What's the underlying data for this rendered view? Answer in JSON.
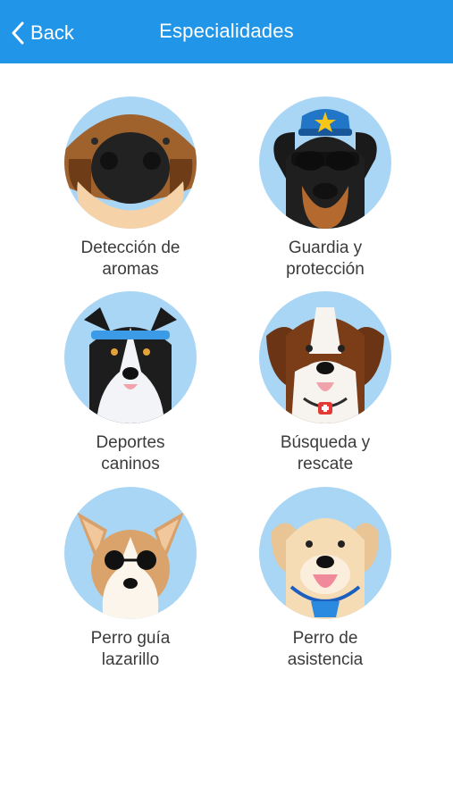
{
  "nav": {
    "back_label": "Back",
    "title": "Especialidades",
    "color": "#2196e8"
  },
  "items": [
    {
      "label_1": "Detección de",
      "label_2": "aromas",
      "icon": "scent-detection-dog-icon"
    },
    {
      "label_1": "Guardia y",
      "label_2": "protección",
      "icon": "guard-dog-icon"
    },
    {
      "label_1": "Deportes",
      "label_2": "caninos",
      "icon": "sports-dog-icon"
    },
    {
      "label_1": "Búsqueda y",
      "label_2": "rescate",
      "icon": "rescue-dog-icon"
    },
    {
      "label_1": "Perro guía",
      "label_2": "lazarillo",
      "icon": "guide-dog-icon"
    },
    {
      "label_1": "Perro de",
      "label_2": "asistencia",
      "icon": "assistance-dog-icon"
    }
  ],
  "colors": {
    "circle": "#a9d6f5",
    "text": "#3b3b3b"
  }
}
